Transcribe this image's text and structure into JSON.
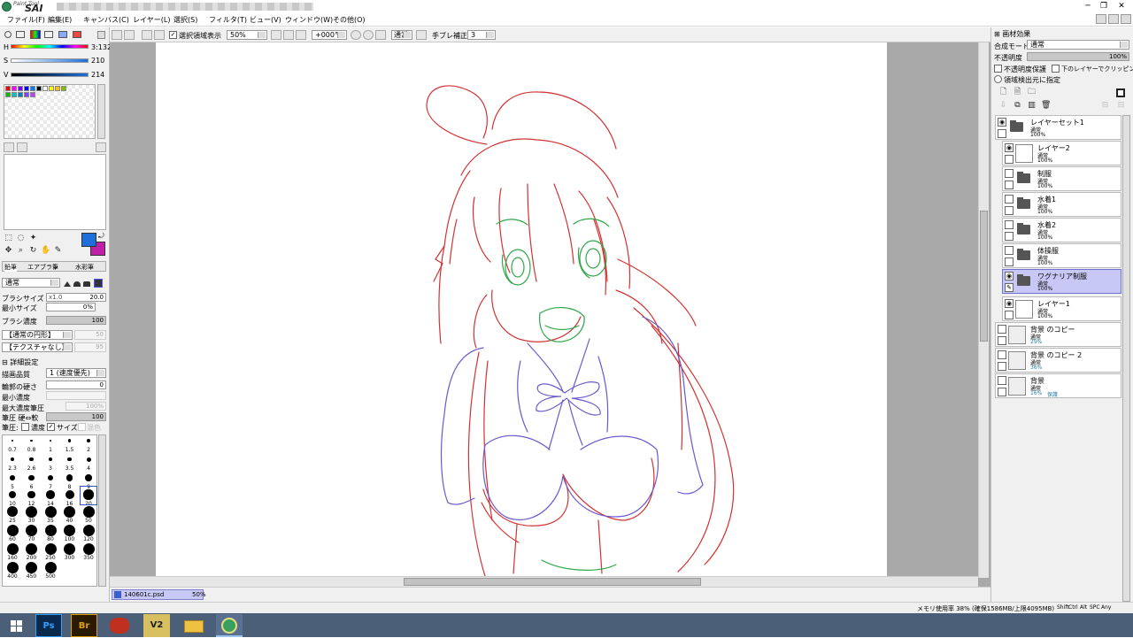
{
  "app": {
    "logo_small": "Paint Tool",
    "logo_big": "SAI"
  },
  "window_buttons": {
    "minimize": "─",
    "restore": "❐",
    "close": "✕"
  },
  "menu": [
    "ファイル(F)",
    "編集(E)",
    "キャンバス(C)",
    "レイヤー(L)",
    "選択(S)",
    "フィルタ(T)",
    "ビュー(V)",
    "ウィンドウ(W)",
    "その他(O)"
  ],
  "toolbar": {
    "show_selection_label": "選択領域表示",
    "zoom": "50%",
    "rotation": "+000°",
    "blend": "通常",
    "stabilizer_label": "手ブレ補正",
    "stabilizer_value": "3"
  },
  "color": {
    "h_label": "H",
    "h_value": "3:132",
    "s_label": "S",
    "s_value": "210",
    "v_label": "V",
    "v_value": "214",
    "primary": "#1e6fd9",
    "secondary": "#c020a8",
    "swatches": [
      "#ff0000",
      "#ff00ff",
      "#8000ff",
      "#0000ff",
      "#0080ff",
      "#000000",
      "#ffffff",
      "#ffff00",
      "#ffc000",
      "#80c000",
      "#00c000",
      "#00c0c0",
      "#0080c0",
      "#8040ff",
      "#c040ff"
    ]
  },
  "tool_tabs": [
    "鉛筆",
    "エアブラシ",
    "筆",
    "水彩筆"
  ],
  "brush": {
    "mode": "通常",
    "size_label": "ブラシサイズ",
    "size_mult": "x1.0",
    "size_value": "20.0",
    "min_size_label": "最小サイズ",
    "min_size_value": "0%",
    "density_label": "ブラシ濃度",
    "density_value": "100",
    "shape": "【通常の円形】",
    "shape_value": "50",
    "texture": "【テクスチャなし】",
    "texture_value": "95",
    "detail_label": "詳細設定",
    "quality_label": "描画品質",
    "quality_value": "1 (速度優先)",
    "edge_label": "輪郭の硬さ",
    "edge_value": "0",
    "min_density_label": "最小濃度",
    "max_pressure_label": "最大濃度筆圧",
    "max_pressure_value": "100%",
    "pressure_label": "筆圧 硬⇔軟",
    "pressure_value": "100",
    "pressure2_label": "筆圧:",
    "pressure_density": "濃度",
    "pressure_size": "サイズ",
    "pressure_blend": "混色"
  },
  "brush_sizes": [
    "0.7",
    "0.8",
    "1",
    "1.5",
    "2",
    "2.3",
    "2.6",
    "3",
    "3.5",
    "4",
    "5",
    "6",
    "7",
    "8",
    "9",
    "10",
    "12",
    "14",
    "16",
    "20",
    "25",
    "30",
    "35",
    "40",
    "50",
    "60",
    "70",
    "80",
    "100",
    "120",
    "160",
    "200",
    "250",
    "300",
    "350",
    "400",
    "450",
    "500"
  ],
  "right": {
    "effects_label": "画材効果",
    "blend_label": "合成モード",
    "blend_value": "通常",
    "opacity_label": "不透明度",
    "opacity_value": "100%",
    "preserve_opacity": "不透明度保護",
    "clip_label": "下のレイヤーでクリッピング",
    "select_source": "領域検出元に指定"
  },
  "layers": [
    {
      "name": "レイヤーセット1",
      "mode": "通常",
      "opacity": "100%"
    },
    {
      "name": "レイヤー2",
      "mode": "通常",
      "opacity": "100%"
    },
    {
      "name": "制服",
      "mode": "通常",
      "opacity": "100%"
    },
    {
      "name": "水着1",
      "mode": "通常",
      "opacity": "100%"
    },
    {
      "name": "水着2",
      "mode": "通常",
      "opacity": "100%"
    },
    {
      "name": "体操服",
      "mode": "通常",
      "opacity": "100%"
    },
    {
      "name": "ワグナリア制服",
      "mode": "通常",
      "opacity": "100%"
    },
    {
      "name": "レイヤー1",
      "mode": "通常",
      "opacity": "100%"
    },
    {
      "name": "背景 のコピー",
      "mode": "通常",
      "opacity": "29%"
    },
    {
      "name": "背景 のコピー 2",
      "mode": "通常",
      "opacity": "36%"
    },
    {
      "name": "背景",
      "mode": "通常",
      "opacity": "16%",
      "extra": "保護"
    }
  ],
  "doc_tab": {
    "name": "140601c.psd",
    "zoom": "50%"
  },
  "status": {
    "memory": "メモリ使用率 38% (確保1586MB/上限4095MB)",
    "keys": [
      "Shift",
      "Ctrl",
      "Alt",
      "SPC",
      "Any"
    ]
  }
}
